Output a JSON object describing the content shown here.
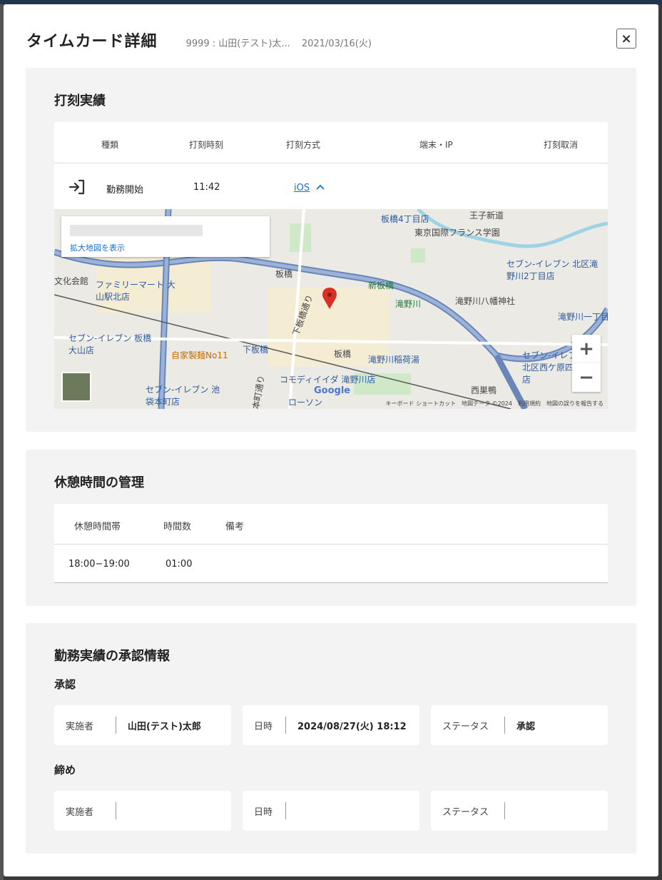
{
  "modal": {
    "title": "タイムカード詳細",
    "subtitle": "9999 : 山田(テスト)太...",
    "date": "2021/03/16(火)",
    "close_label": "×"
  },
  "punch": {
    "title": "打刻実績",
    "headers": [
      "種類",
      "打刻時刻",
      "打刻方式",
      "端末・IP",
      "打刻取消"
    ],
    "row": {
      "type": "勤務開始",
      "time": "11:42",
      "method": "iOS",
      "icon": "login-icon"
    },
    "map": {
      "link_label": "拡大地図を表示",
      "attribution": "キーボード ショートカット　地図データ ©2024　利用規約　地図の誤りを報告する",
      "google_label": "Google",
      "zoom_in": "+",
      "zoom_out": "−",
      "labels": [
        "板橋4丁目店",
        "東京国際フランス学園",
        "王子新道",
        "セブン-イレブン 北区滝野川2丁目店",
        "文化会館",
        "ファミリーマート 大山駅北店",
        "板橋",
        "新板橋",
        "滝野川",
        "滝野川八幡神社",
        "下板橋通り",
        "セブン-イレブン 板橋大山店",
        "自家製麺No11",
        "下板橋",
        "板橋",
        "滝野川稲荷湯",
        "コモディイイダ 滝野川店",
        "セブン-イレブン 池袋本町店",
        "セブン-イレブン 北区西ケ原四丁目店",
        "西巣鴨",
        "滝野川一丁目",
        "本町通り",
        "ローソン"
      ]
    }
  },
  "break": {
    "title": "休憩時間の管理",
    "headers": [
      "休憩時間帯",
      "時間数",
      "備考"
    ],
    "row": {
      "range": "18:00−19:00",
      "hours": "01:00",
      "note": ""
    }
  },
  "approval": {
    "title": "勤務実績の承認情報",
    "approve": {
      "heading": "承認",
      "executor_label": "実施者",
      "executor": "山田(テスト)太郎",
      "datetime_label": "日時",
      "datetime": "2024/08/27(火) 18:12",
      "status_label": "ステータス",
      "status": "承認"
    },
    "close": {
      "heading": "締め",
      "executor_label": "実施者",
      "executor": "",
      "datetime_label": "日時",
      "datetime": "",
      "status_label": "ステータス",
      "status": ""
    }
  },
  "colors": {
    "accent": "#1a6fd0",
    "section_bg": "#f3f3f3",
    "marker": "#d93025"
  }
}
